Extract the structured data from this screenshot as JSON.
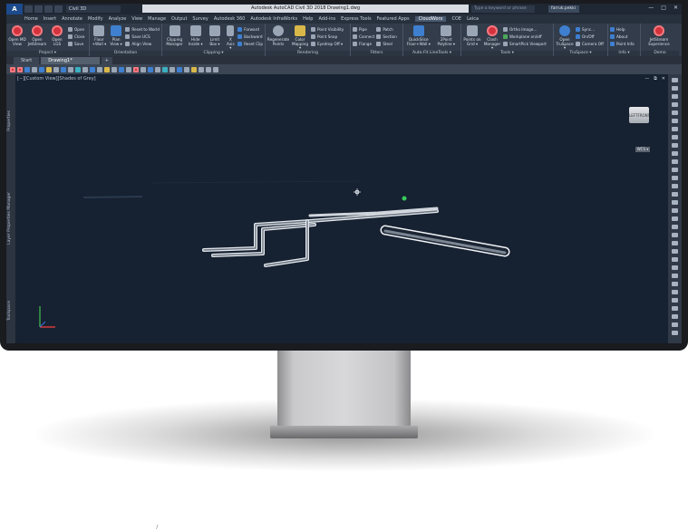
{
  "titlebar": {
    "app_logo": "A",
    "workspace": "Civil 3D",
    "title": "Autodesk AutoCAD Civil 3D 2018   Drawing1.dwg",
    "search_placeholder": "Type a keyword or phrase",
    "user": "farruk.pekki",
    "window_controls": [
      "—",
      "□",
      "✕"
    ]
  },
  "ribbon_tabs": [
    "Home",
    "Insert",
    "Annotate",
    "Modify",
    "Analyze",
    "View",
    "Manage",
    "Output",
    "Survey",
    "Autodesk 360",
    "Autodesk InfraWorks",
    "Help",
    "Add-ins",
    "Express Tools",
    "Featured Apps",
    "CloudWorx",
    "COE",
    "Leica"
  ],
  "active_ribbon_tab": "CloudWorx",
  "ribbon": {
    "project": {
      "title": "Project ▾",
      "open_md_view": "Open MD View",
      "open_jetstream": "Open JetStream",
      "open_lgs": "Open LGS",
      "open": "Open",
      "close": "Close",
      "save": "Save"
    },
    "orientation": {
      "title": "Orientation",
      "floor_wall": "Floor +Wall ▾",
      "plan_view": "Plan View ▾",
      "reset_to_world": "Reset to World",
      "save_ucs": "Save UCS",
      "align_view": "Align View"
    },
    "clipping": {
      "title": "Clipping ▾",
      "clipping_manager": "Clipping Manager",
      "hide_inside": "Hide Inside ▾",
      "limit_box": "Limit Box ▾",
      "x_axis": "X Axis ▾",
      "forward": "Forward",
      "backward": "Backward",
      "reset_clip": "Reset Clip"
    },
    "rendering": {
      "title": "Rendering",
      "regenerate_points": "Regenerate Points",
      "color_mapping": "Color Mapping ▾",
      "point_visibility": "Point Visibility",
      "point_snap": "Point Snap",
      "eyedrop_off": "Eyedrop Off ▾"
    },
    "fitters": {
      "title": "Fitters",
      "pipe": "Pipe",
      "connect": "Connect",
      "flange": "Flange",
      "patch": "Patch",
      "section": "Section",
      "steel": "Steel"
    },
    "autofit": {
      "title": "Auto-Fit LineTools ▾",
      "quickslice": "QuickSlice Floor+Wall ▾",
      "polyline": "2Point Polyline ▾"
    },
    "tools": {
      "title": "Tools ▾",
      "points_on_grid": "Points on Grid ▾",
      "clash_manager": "Clash Manager ▾",
      "ortho_image": "Ortho Image...",
      "workplane_on_off": "Workplane on/off",
      "smartpick_viewport": "SmartPick Viewport"
    },
    "truspace": {
      "title": "TruSpace ▾",
      "open_truspace": "Open TruSpace ▾",
      "sync": "Sync...",
      "on_off": "On/Off",
      "camera_off": "Camera Off"
    },
    "info": {
      "title": "Info ▾",
      "help": "Help",
      "about": "About",
      "point_info": "Point Info"
    },
    "demo": {
      "title": "Demo",
      "jetstream_experience": "JetStream Experience"
    }
  },
  "doc_tabs": {
    "start": "Start",
    "drawing": "Drawing1*",
    "close": "✕",
    "add": "+"
  },
  "viewport": {
    "label": "[−][Custom View][Shades of Grey]",
    "controls": [
      "—",
      "⧉",
      "✕"
    ],
    "viewcube_faces": [
      "LEFT",
      "FRONT"
    ],
    "wcs": "WCS ▾"
  },
  "side_palettes": [
    "Properties",
    "Layer Properties Manager",
    "Toolspace"
  ],
  "stray_mark": "/",
  "colors": {
    "bezel": "#1a1b1e",
    "viewport_bg": "#162131",
    "ribbon_bg": "#323c4a",
    "accent_red": "#d4323c",
    "pipe": "#dfe3e8"
  }
}
